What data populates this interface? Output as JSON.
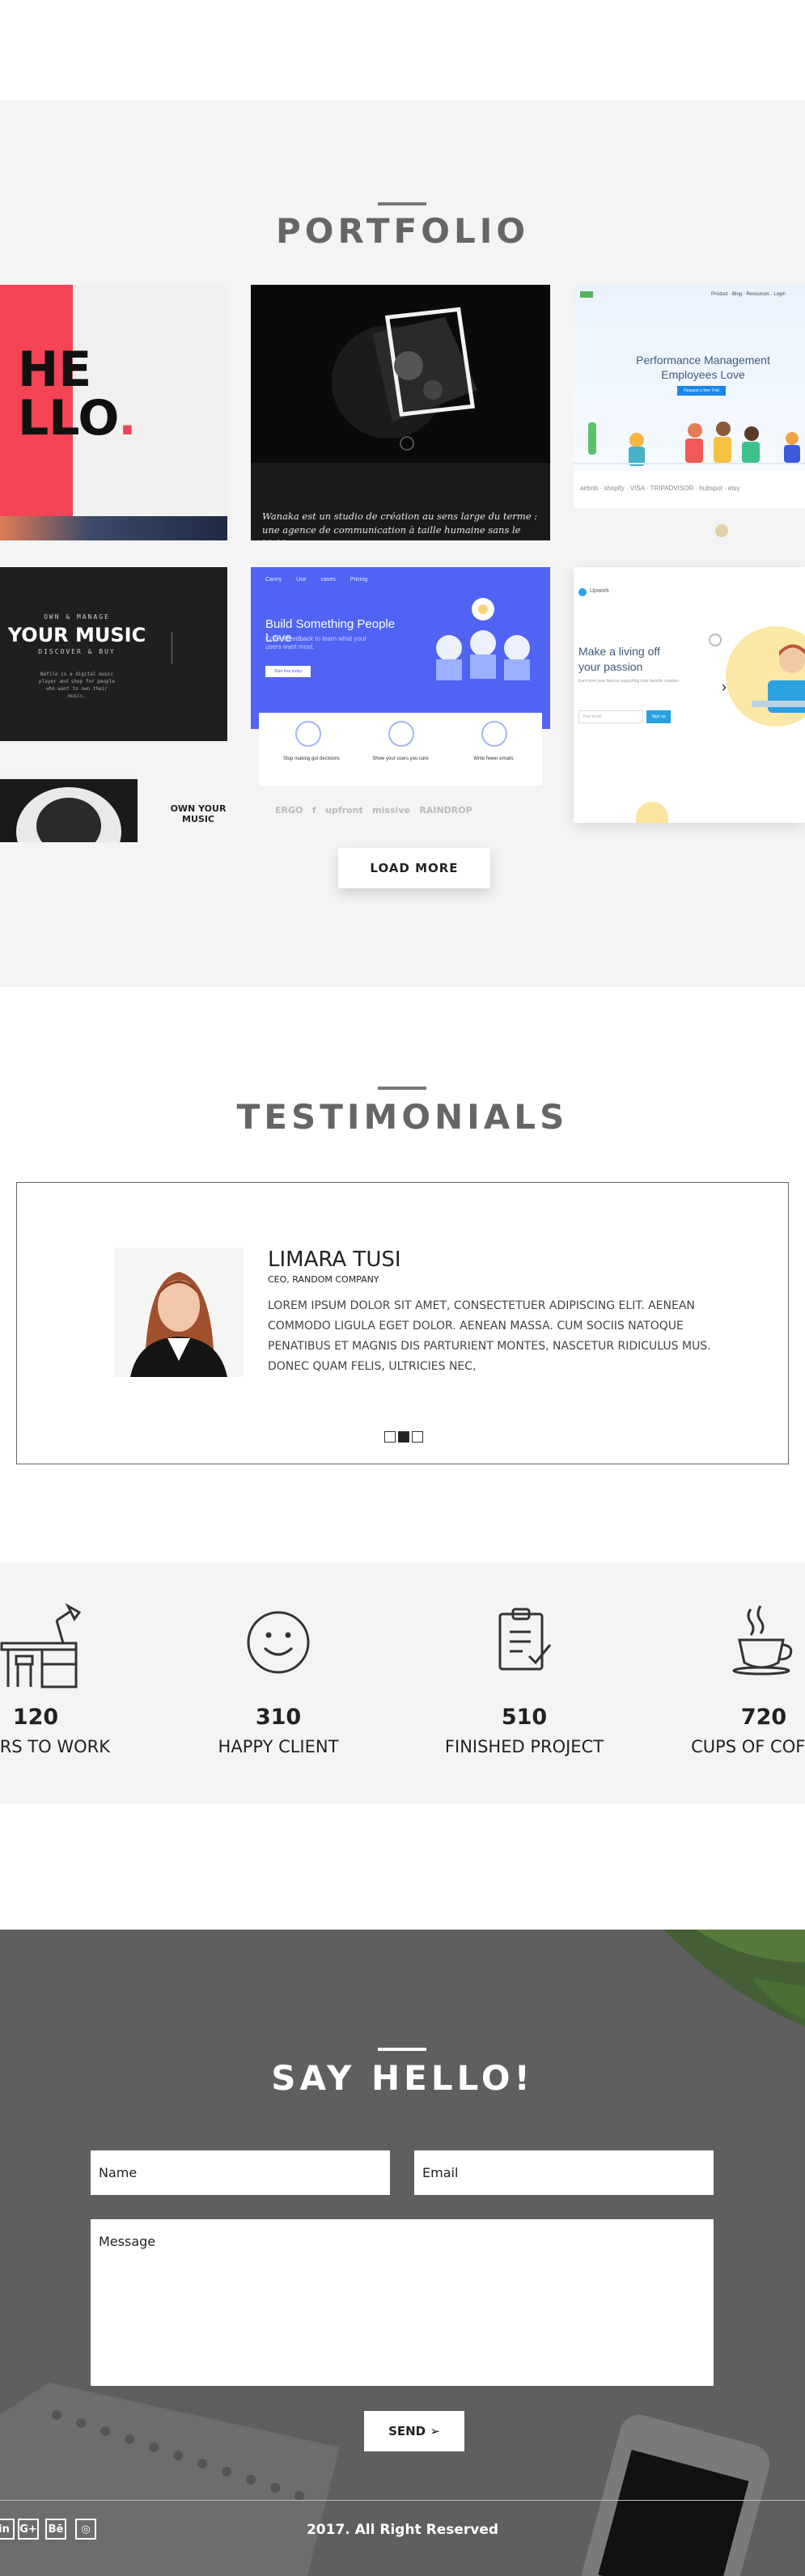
{
  "portfolio": {
    "title": "PORTFOLIO",
    "load_more_label": "LOAD MORE",
    "tiles": {
      "hello": {
        "text_line1": "HE",
        "text_line2": "LLO"
      },
      "wanaka": {
        "caption": "Wanaka est un studio de création au sens large du terme : une agence de communication à taille humaine sans le blabla qui va"
      },
      "performance": {
        "heading": "Performance Management Employees Love",
        "cta": "Request a free Trial",
        "logos": [
          "airbnb",
          "shopify",
          "VISA",
          "TRIPADVISOR",
          "hubspot",
          "etsy"
        ]
      },
      "music": {
        "kicker": "OWN & MANAGE",
        "title": "YOUR MUSIC",
        "subtitle": "DISCOVER & BUY",
        "body": "Nefile is a digital music player and shop for people who want to own their music.",
        "footer": "OWN YOUR MUSIC"
      },
      "build": {
        "nav": [
          "Canny",
          "Use cases",
          "Pricing",
          "Log in"
        ],
        "heading": "Build Something People Love",
        "sub": "Collect feedback to learn what your users want most.",
        "cta": "Start free today",
        "features": [
          "Stop making gut decisions",
          "Show your users you care",
          "Write fewer emails"
        ],
        "logos": [
          "ERGO",
          "f",
          "upfront",
          "missive",
          "RAINDROP"
        ]
      },
      "living": {
        "brand": "Upwork",
        "heading": "Make a living off your passion",
        "body": "Earn from your fans by supporting their favorite creators",
        "cta": "Sign up"
      }
    }
  },
  "testimonials": {
    "title": "TESTIMONIALS",
    "name": "LIMARA TUSI",
    "role": "CEO, RANDOM COMPANY",
    "quote": "LOREM IPSUM DOLOR SIT AMET, CONSECTETUER ADIPISCING ELIT. AENEAN COMMODO LIGULA EGET DOLOR. AENEAN MASSA. CUM SOCIIS NATOQUE PENATIBUS ET MAGNIS DIS PARTURIENT MONTES, NASCETUR RIDICULUS MUS. DONEC QUAM FELIS, ULTRICIES NEC,",
    "active_dot": 2
  },
  "stats": [
    {
      "icon": "desk-icon",
      "number": "120",
      "label": "HOURS TO WORK"
    },
    {
      "icon": "smile-icon",
      "number": "310",
      "label": "HAPPY CLIENT"
    },
    {
      "icon": "clipboard-icon",
      "number": "510",
      "label": "FINISHED PROJECT"
    },
    {
      "icon": "coffee-cup-icon",
      "number": "720",
      "label": "CUPS OF COFFEE"
    }
  ],
  "contact": {
    "title": "SAY HELLO!",
    "name_placeholder": "Name",
    "email_placeholder": "Email",
    "message_placeholder": "Message",
    "send_label": "SEND ➢",
    "copyright": "2017. All Right Reserved",
    "socials": [
      "in",
      "G+",
      "Bē",
      "◎"
    ]
  },
  "colors": {
    "accent_red": "#f44455",
    "accent_blue": "#4a5cf2",
    "section_gray": "#f4f4f4",
    "contact_bg": "#5f5f5f"
  }
}
